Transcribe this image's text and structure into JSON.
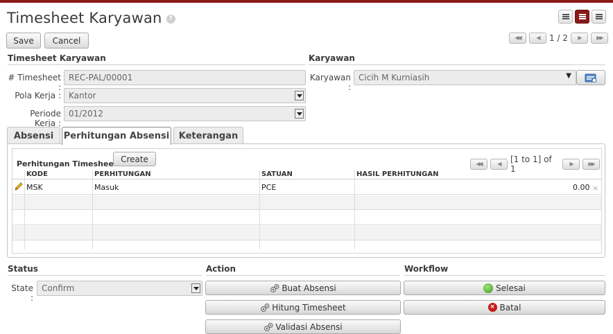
{
  "header": {
    "title": "Timesheet Karyawan",
    "help_mark": "?"
  },
  "toolbar": {
    "save_label": "Save",
    "cancel_label": "Cancel",
    "pager_text": "1 / 2"
  },
  "form": {
    "section_left": "Timesheet Karyawan",
    "section_right": "Karyawan",
    "timesheet_label": "# Timesheet :",
    "timesheet_value": "REC-PAL/00001",
    "pola_label": "Pola Kerja :",
    "pola_value": "Kantor",
    "periode_label": "Periode Kerja :",
    "periode_value": "01/2012",
    "karyawan_label": "Karyawan :",
    "karyawan_value": "Cicih M Kurniasih"
  },
  "tabs": [
    {
      "label": "Absensi"
    },
    {
      "label": "Perhitungan Absensi"
    },
    {
      "label": "Keterangan"
    }
  ],
  "grid": {
    "title": "Perhitungan Timesheet",
    "create_label": "Create",
    "pager_text": "[1 to 1] of 1",
    "columns": [
      "KODE",
      "PERHITUNGAN",
      "SATUAN",
      "HASIL PERHITUNGAN"
    ],
    "rows": [
      {
        "kode": "MSK",
        "perhitungan": "Masuk",
        "satuan": "PCE",
        "hasil": "0.00",
        "delete": "×"
      }
    ]
  },
  "status": {
    "section": "Status",
    "state_label": "State :",
    "state_value": "Confirm"
  },
  "action": {
    "section": "Action",
    "buttons": [
      "Buat Absensi",
      "Hitung Timesheet",
      "Validasi Absensi"
    ]
  },
  "workflow": {
    "section": "Workflow",
    "selesai_label": "Selesai",
    "batal_label": "Batal"
  }
}
